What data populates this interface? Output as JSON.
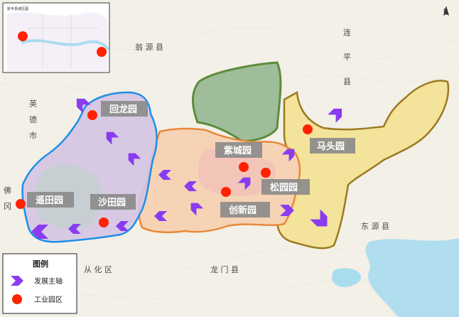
{
  "map": {
    "inset_title": "新丰县城区图",
    "compass": "N",
    "parks": [
      {
        "name": "回龙园"
      },
      {
        "name": "遥田园"
      },
      {
        "name": "沙田园"
      },
      {
        "name": "紫城园"
      },
      {
        "name": "松园园"
      },
      {
        "name": "创新园"
      },
      {
        "name": "马头园"
      }
    ],
    "place_labels": {
      "yingde": "英 德 市",
      "fo_gang": "佛 冈",
      "wengyuan": "翁 源 县",
      "lianping": "连 平 县",
      "conghua": "从 化 区",
      "longmen": "龙 门 县",
      "dongyuan": "东 源 县"
    },
    "legend": {
      "title": "图例",
      "items": [
        {
          "label": "发展主轴",
          "symbol": "arrow",
          "color": "#8a3cf0"
        },
        {
          "label": "工业园区",
          "symbol": "dot",
          "color": "#ff2200"
        }
      ]
    },
    "colors": {
      "arrow": "#8a3cf0",
      "dot": "#ff2200",
      "green_zone": "#8fb48c",
      "yellow_zone": "#f3e39b",
      "orange_zone": "#f6d3b5",
      "purple_zone": "#d4c4e2",
      "label_bg": "#8a8a8a",
      "water": "#a9dcef"
    }
  }
}
